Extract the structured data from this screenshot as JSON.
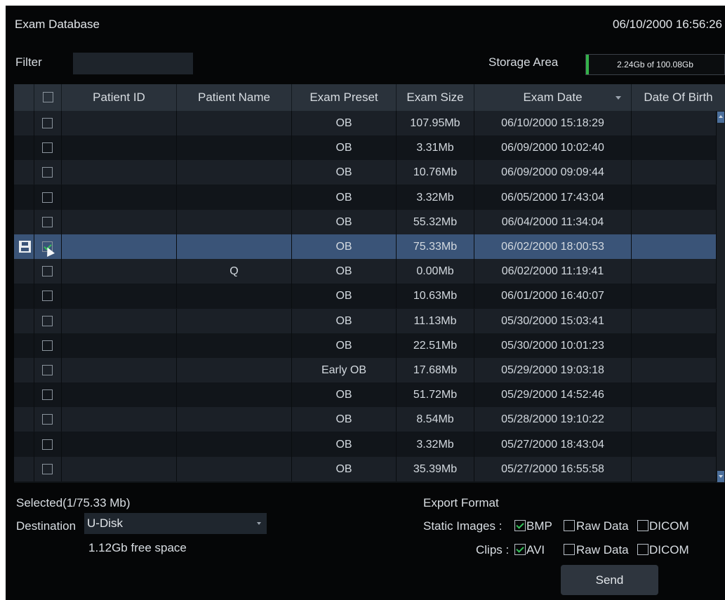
{
  "header": {
    "title": "Exam Database",
    "datetime": "06/10/2000 16:56:26"
  },
  "filter": {
    "label": "Filter",
    "value": ""
  },
  "storage": {
    "label": "Storage Area",
    "text": "2.24Gb of 100.08Gb",
    "used_fraction": 0.0224,
    "fill_color": "#34b24a"
  },
  "table": {
    "columns": [
      "",
      "",
      "Patient ID",
      "Patient Name",
      "Exam Preset",
      "Exam Size",
      "Exam Date",
      "Date Of Birth"
    ],
    "sorted_column": "Exam Date",
    "selected_color": "#3a5478",
    "rows": [
      {
        "checked": false,
        "patient_id": "",
        "patient_name": "",
        "preset": "OB",
        "size": "107.95Mb",
        "date": "06/10/2000 15:18:29",
        "dob": ""
      },
      {
        "checked": false,
        "patient_id": "",
        "patient_name": "",
        "preset": "OB",
        "size": "3.31Mb",
        "date": "06/09/2000 10:02:40",
        "dob": ""
      },
      {
        "checked": false,
        "patient_id": "",
        "patient_name": "",
        "preset": "OB",
        "size": "10.76Mb",
        "date": "06/09/2000 09:09:44",
        "dob": ""
      },
      {
        "checked": false,
        "patient_id": "",
        "patient_name": "",
        "preset": "OB",
        "size": "3.32Mb",
        "date": "06/05/2000 17:43:04",
        "dob": ""
      },
      {
        "checked": false,
        "patient_id": "",
        "patient_name": "",
        "preset": "OB",
        "size": "55.32Mb",
        "date": "06/04/2000 11:34:04",
        "dob": ""
      },
      {
        "checked": true,
        "selected": true,
        "saved": true,
        "patient_id": "",
        "patient_name": "",
        "preset": "OB",
        "size": "75.33Mb",
        "date": "06/02/2000 18:00:53",
        "dob": ""
      },
      {
        "checked": false,
        "patient_id": "",
        "patient_name": "Q",
        "preset": "OB",
        "size": "0.00Mb",
        "date": "06/02/2000 11:19:41",
        "dob": ""
      },
      {
        "checked": false,
        "patient_id": "",
        "patient_name": "",
        "preset": "OB",
        "size": "10.63Mb",
        "date": "06/01/2000 16:40:07",
        "dob": ""
      },
      {
        "checked": false,
        "patient_id": "",
        "patient_name": "",
        "preset": "OB",
        "size": "11.13Mb",
        "date": "05/30/2000 15:03:41",
        "dob": ""
      },
      {
        "checked": false,
        "patient_id": "",
        "patient_name": "",
        "preset": "OB",
        "size": "22.51Mb",
        "date": "05/30/2000 10:01:23",
        "dob": ""
      },
      {
        "checked": false,
        "patient_id": "",
        "patient_name": "",
        "preset": "Early OB",
        "size": "17.68Mb",
        "date": "05/29/2000 19:03:18",
        "dob": ""
      },
      {
        "checked": false,
        "patient_id": "",
        "patient_name": "",
        "preset": "OB",
        "size": "51.72Mb",
        "date": "05/29/2000 14:52:46",
        "dob": ""
      },
      {
        "checked": false,
        "patient_id": "",
        "patient_name": "",
        "preset": "OB",
        "size": "8.54Mb",
        "date": "05/28/2000 19:10:22",
        "dob": ""
      },
      {
        "checked": false,
        "patient_id": "",
        "patient_name": "",
        "preset": "OB",
        "size": "3.32Mb",
        "date": "05/27/2000 18:43:04",
        "dob": ""
      },
      {
        "checked": false,
        "patient_id": "",
        "patient_name": "",
        "preset": "OB",
        "size": "35.39Mb",
        "date": "05/27/2000 16:55:58",
        "dob": ""
      }
    ]
  },
  "footer": {
    "selected_summary": "Selected(1/75.33 Mb)",
    "destination_label": "Destination",
    "destination_value": "U-Disk",
    "free_space": "1.12Gb free space",
    "export_title": "Export Format",
    "static_label": "Static Images :",
    "clips_label": "Clips :",
    "static_options": [
      {
        "label": "BMP",
        "checked": true
      },
      {
        "label": "Raw Data",
        "checked": false
      },
      {
        "label": "DICOM",
        "checked": false
      }
    ],
    "clip_options": [
      {
        "label": "AVI",
        "checked": true
      },
      {
        "label": "Raw Data",
        "checked": false
      },
      {
        "label": "DICOM",
        "checked": false
      }
    ],
    "send_label": "Send"
  }
}
